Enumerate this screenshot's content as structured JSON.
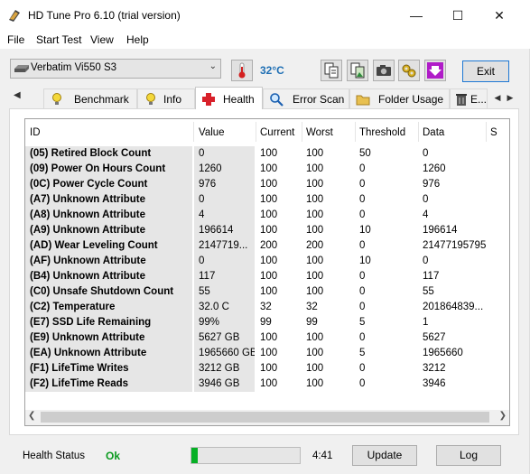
{
  "window": {
    "title": "HD Tune Pro 6.10 (trial version)",
    "minimize": "—",
    "maximize": "☐",
    "close": "✕"
  },
  "menu": [
    "File",
    "Start Test",
    "View",
    "Help"
  ],
  "toolbar": {
    "drive": "Verbatim Vi550 S3",
    "temperature": "32°C",
    "exit_label": "Exit"
  },
  "tabs": [
    {
      "label": "Benchmark",
      "icon": "bulb-icon",
      "active": false
    },
    {
      "label": "Info",
      "icon": "info-bulb-icon",
      "active": false
    },
    {
      "label": "Health",
      "icon": "health-cross-icon",
      "active": true
    },
    {
      "label": "Error Scan",
      "icon": "magnifier-icon",
      "active": false
    },
    {
      "label": "Folder Usage",
      "icon": "folder-icon",
      "active": false
    },
    {
      "label": "E...",
      "icon": "trash-icon",
      "active": false
    }
  ],
  "table": {
    "headers": [
      "ID",
      "Value",
      "Current",
      "Worst",
      "Threshold",
      "Data",
      "S"
    ],
    "rows": [
      [
        "(05) Retired Block Count",
        "0",
        "100",
        "100",
        "50",
        "0"
      ],
      [
        "(09) Power On Hours Count",
        "1260",
        "100",
        "100",
        "0",
        "1260"
      ],
      [
        "(0C) Power Cycle Count",
        "976",
        "100",
        "100",
        "0",
        "976"
      ],
      [
        "(A7) Unknown Attribute",
        "0",
        "100",
        "100",
        "0",
        "0"
      ],
      [
        "(A8) Unknown Attribute",
        "4",
        "100",
        "100",
        "0",
        "4"
      ],
      [
        "(A9) Unknown Attribute",
        "196614",
        "100",
        "100",
        "10",
        "196614"
      ],
      [
        "(AD) Wear Leveling Count",
        "2147719...",
        "200",
        "200",
        "0",
        "21477195795"
      ],
      [
        "(AF) Unknown Attribute",
        "0",
        "100",
        "100",
        "10",
        "0"
      ],
      [
        "(B4) Unknown Attribute",
        "117",
        "100",
        "100",
        "0",
        "117"
      ],
      [
        "(C0) Unsafe Shutdown Count",
        "55",
        "100",
        "100",
        "0",
        "55"
      ],
      [
        "(C2) Temperature",
        "32.0 C",
        "32",
        "32",
        "0",
        "201864839..."
      ],
      [
        "(E7) SSD Life Remaining",
        "99%",
        "99",
        "99",
        "5",
        "1"
      ],
      [
        "(E9) Unknown Attribute",
        "5627 GB",
        "100",
        "100",
        "0",
        "5627"
      ],
      [
        "(EA) Unknown Attribute",
        "1965660 GB",
        "100",
        "100",
        "5",
        "1965660"
      ],
      [
        "(F1) LifeTime Writes",
        "3212 GB",
        "100",
        "100",
        "0",
        "3212"
      ],
      [
        "(F2) LifeTime Reads",
        "3946 GB",
        "100",
        "100",
        "0",
        "3946"
      ]
    ]
  },
  "status": {
    "health_label": "Health Status",
    "health_value": "Ok",
    "progress_fraction": 0.06,
    "time": "4:41",
    "update_label": "Update",
    "log_label": "Log"
  },
  "colors": {
    "temperature": "#1f6fb4",
    "health_ok": "#0a9a1e",
    "progress": "#06b025"
  }
}
